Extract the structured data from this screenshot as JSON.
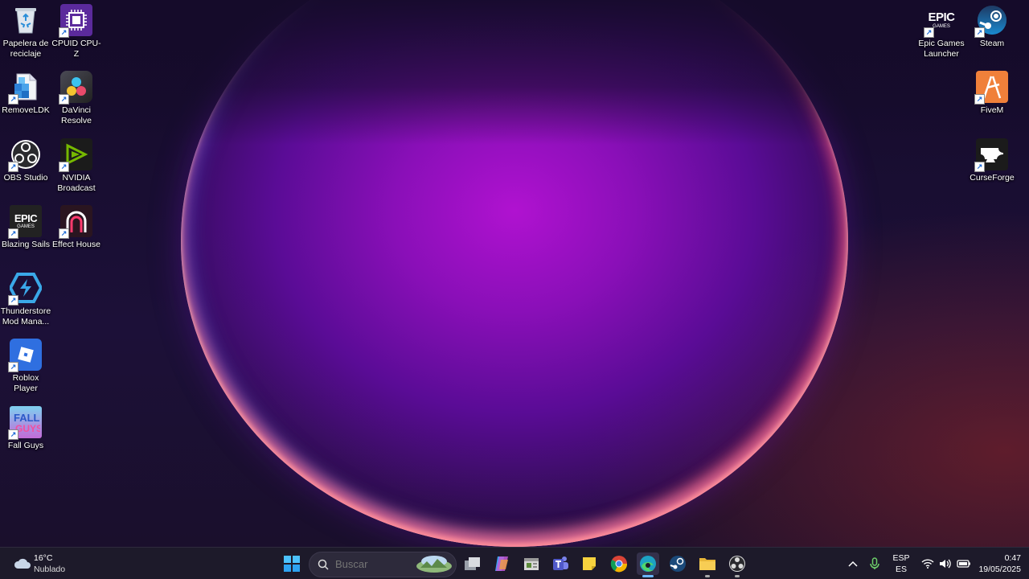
{
  "desktop": {
    "icons_left": [
      {
        "label": "Papelera de reciclaje",
        "icon": "recycle-bin-icon"
      },
      {
        "label": "CPUID CPU-Z",
        "icon": "cpuz-icon"
      },
      {
        "label": "RemoveLDK",
        "icon": "removeldk-icon"
      },
      {
        "label": "DaVinci Resolve",
        "icon": "davinci-icon"
      },
      {
        "label": "OBS Studio",
        "icon": "obs-icon"
      },
      {
        "label": "NVIDIA Broadcast",
        "icon": "nvidia-icon"
      },
      {
        "label": "Blazing Sails",
        "icon": "epic-icon"
      },
      {
        "label": "Effect House",
        "icon": "effect-house-icon"
      },
      {
        "label": "Thunderstore Mod Mana...",
        "icon": "thunderstore-icon"
      },
      {
        "label": "Roblox Player",
        "icon": "roblox-icon"
      },
      {
        "label": "Fall Guys",
        "icon": "fallguys-icon"
      }
    ],
    "icons_right": [
      {
        "label": "Epic Games Launcher",
        "icon": "epic-icon"
      },
      {
        "label": "Steam",
        "icon": "steam-icon"
      },
      {
        "label": "FiveM",
        "icon": "fivem-icon"
      },
      {
        "label": "CurseForge",
        "icon": "curseforge-icon"
      }
    ],
    "epic_text": "EPIC",
    "epic_sub": "GAMES"
  },
  "taskbar": {
    "weather": {
      "temp": "16°C",
      "condition": "Nublado",
      "icon": "cloud-icon"
    },
    "search": {
      "placeholder": "Buscar"
    },
    "apps": [
      "start-icon",
      "task-view-icon",
      "copilot-icon",
      "file-icon",
      "teams-icon",
      "sticky-notes-icon",
      "chrome-icon",
      "edge-icon",
      "steam-icon",
      "file-explorer-icon",
      "obs-icon"
    ],
    "tray": {
      "lang_top": "ESP",
      "lang_bottom": "ES",
      "time": "0:47",
      "date": "19/05/2025"
    }
  },
  "colors": {
    "taskbar_bg": "#1d1a2a",
    "accent": "#1c6ad6"
  }
}
